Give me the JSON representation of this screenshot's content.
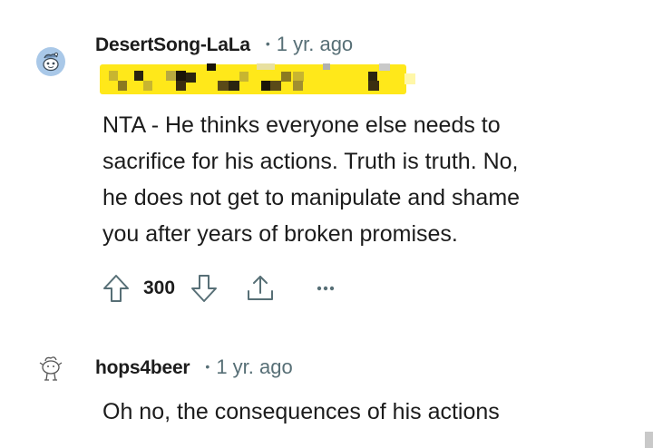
{
  "comments": [
    {
      "username": "DesertSong-LaLa",
      "separator": "•",
      "time": "1 yr. ago",
      "text_lines": [
        "NTA - He thinks everyone else needs to",
        "sacrifice for his actions. Truth is truth. No,",
        "he does not get to manipulate and shame",
        "you after years of broken promises."
      ],
      "score": "300",
      "avatar_icon": "snoo-avatar-icon",
      "avatar_color": "#a9c8e8",
      "flair_censored": true
    },
    {
      "username": "hops4beer",
      "separator": "•",
      "time": "1 yr. ago",
      "text_lines": [
        "Oh no, the consequences of his actions"
      ],
      "avatar_icon": "snoo-outline-avatar-icon"
    }
  ],
  "actions": {
    "upvote_icon": "arrow-up-icon",
    "downvote_icon": "arrow-down-icon",
    "share_icon": "share-icon",
    "more_icon": "more-dots-icon"
  },
  "colors": {
    "text": "#1c1c1c",
    "meta": "#576f76",
    "icon": "#576f76",
    "censor_yellow": "#ffe81a"
  }
}
